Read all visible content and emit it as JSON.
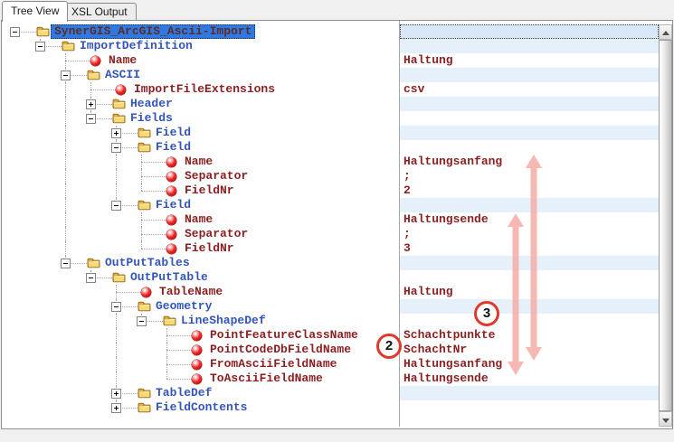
{
  "tabs": {
    "active_label": "Tree View",
    "inactive_label": "XSL Output"
  },
  "tree_rows": [
    {
      "label": "SynerGIS_ArcGIS_Ascii-Import",
      "level": 1,
      "kind": "folder",
      "toggle": "minus",
      "selected": true,
      "stripe": true,
      "value": ""
    },
    {
      "label": "ImportDefinition",
      "level": 2,
      "kind": "folder",
      "toggle": "minus",
      "selected": false,
      "stripe": true,
      "value": ""
    },
    {
      "label": "Name",
      "level": 3,
      "kind": "leaf",
      "toggle": null,
      "selected": false,
      "stripe": false,
      "value": "Haltung"
    },
    {
      "label": "ASCII",
      "level": 3,
      "kind": "folder",
      "toggle": "minus",
      "selected": false,
      "stripe": true,
      "value": ""
    },
    {
      "label": "ImportFileExtensions",
      "level": 4,
      "kind": "leaf",
      "toggle": null,
      "selected": false,
      "stripe": false,
      "value": "csv"
    },
    {
      "label": "Header",
      "level": 4,
      "kind": "folder",
      "toggle": "plus",
      "selected": false,
      "stripe": true,
      "value": ""
    },
    {
      "label": "Fields",
      "level": 4,
      "kind": "folder",
      "toggle": "minus",
      "selected": false,
      "stripe": false,
      "value": ""
    },
    {
      "label": "Field",
      "level": 5,
      "kind": "folder",
      "toggle": "plus",
      "selected": false,
      "stripe": true,
      "value": ""
    },
    {
      "label": "Field",
      "level": 5,
      "kind": "folder",
      "toggle": "minus",
      "selected": false,
      "stripe": false,
      "value": ""
    },
    {
      "label": "Name",
      "level": 6,
      "kind": "leaf",
      "toggle": null,
      "selected": false,
      "stripe": false,
      "value": "Haltungsanfang"
    },
    {
      "label": "Separator",
      "level": 6,
      "kind": "leaf",
      "toggle": null,
      "selected": false,
      "stripe": false,
      "value": ";"
    },
    {
      "label": "FieldNr",
      "level": 6,
      "kind": "leaf",
      "toggle": null,
      "selected": false,
      "stripe": false,
      "value": "2"
    },
    {
      "label": "Field",
      "level": 5,
      "kind": "folder",
      "toggle": "minus",
      "selected": false,
      "stripe": true,
      "value": ""
    },
    {
      "label": "Name",
      "level": 6,
      "kind": "leaf",
      "toggle": null,
      "selected": false,
      "stripe": false,
      "value": "Haltungsende"
    },
    {
      "label": "Separator",
      "level": 6,
      "kind": "leaf",
      "toggle": null,
      "selected": false,
      "stripe": false,
      "value": ";"
    },
    {
      "label": "FieldNr",
      "level": 6,
      "kind": "leaf",
      "toggle": null,
      "selected": false,
      "stripe": false,
      "value": "3"
    },
    {
      "label": "OutPutTables",
      "level": 3,
      "kind": "folder",
      "toggle": "minus",
      "selected": false,
      "stripe": true,
      "value": ""
    },
    {
      "label": "OutPutTable",
      "level": 4,
      "kind": "folder",
      "toggle": "minus",
      "selected": false,
      "stripe": false,
      "value": ""
    },
    {
      "label": "TableName",
      "level": 5,
      "kind": "leaf",
      "toggle": null,
      "selected": false,
      "stripe": false,
      "value": "Haltung"
    },
    {
      "label": "Geometry",
      "level": 5,
      "kind": "folder",
      "toggle": "minus",
      "selected": false,
      "stripe": true,
      "value": ""
    },
    {
      "label": "LineShapeDef",
      "level": 6,
      "kind": "folder",
      "toggle": "minus",
      "selected": false,
      "stripe": false,
      "value": ""
    },
    {
      "label": "PointFeatureClassName",
      "level": 7,
      "kind": "leaf",
      "toggle": null,
      "selected": false,
      "stripe": false,
      "value": "Schachtpunkte"
    },
    {
      "label": "PointCodeDbFieldName",
      "level": 7,
      "kind": "leaf",
      "toggle": null,
      "selected": false,
      "stripe": false,
      "value": "SchachtNr"
    },
    {
      "label": "FromAsciiFieldName",
      "level": 7,
      "kind": "leaf",
      "toggle": null,
      "selected": false,
      "stripe": false,
      "value": "Haltungsanfang"
    },
    {
      "label": "ToAsciiFieldName",
      "level": 7,
      "kind": "leaf",
      "toggle": null,
      "selected": false,
      "stripe": false,
      "value": "Haltungsende"
    },
    {
      "label": "TableDef",
      "level": 5,
      "kind": "folder",
      "toggle": "plus",
      "selected": false,
      "stripe": true,
      "value": ""
    },
    {
      "label": "FieldContents",
      "level": 5,
      "kind": "folder",
      "toggle": "plus",
      "selected": false,
      "stripe": false,
      "value": ""
    }
  ],
  "annotations": {
    "circle_2": "2",
    "circle_3": "3"
  },
  "colors": {
    "stripe_blue": "#e6f0fa",
    "selected_cell_bg": "#d8e8f8",
    "selection_bg": "#3179e2",
    "selection_text": "#5b2d26",
    "element_text": "#3355bb",
    "value_text": "#8b1f1f",
    "annotation_red": "#e0392b",
    "arrow_pink": "#f5aca4"
  }
}
